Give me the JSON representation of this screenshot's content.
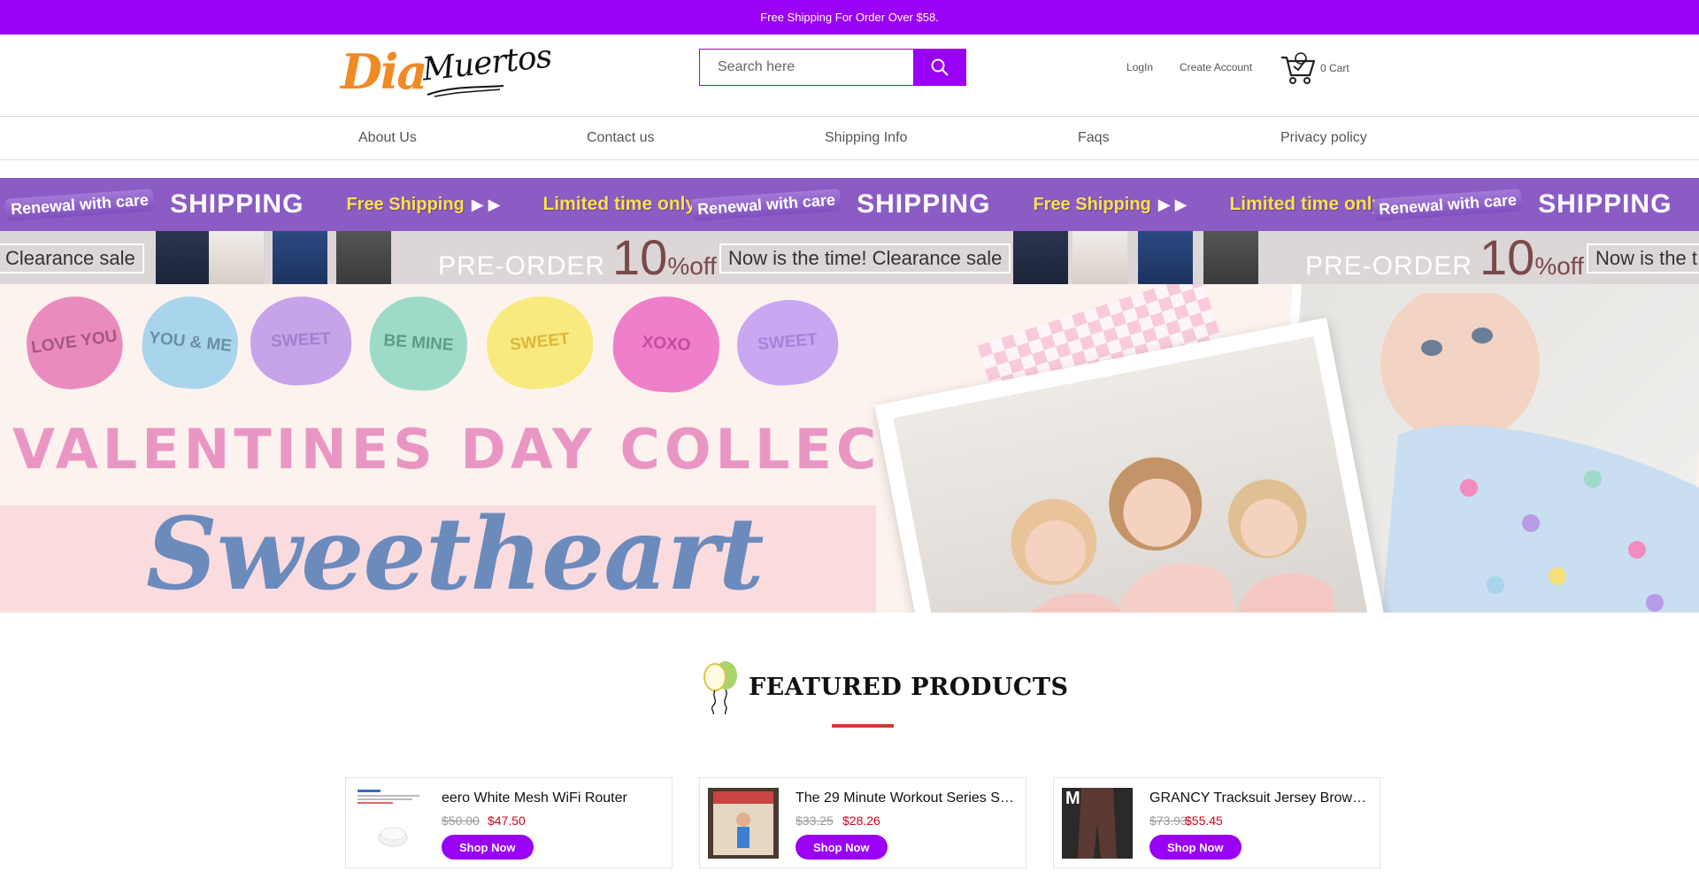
{
  "topbar": {
    "text": "Free Shipping For Order Over $58."
  },
  "header": {
    "logo": {
      "word1": "Dia",
      "word2": "Muertos"
    },
    "search": {
      "placeholder": "Search here"
    },
    "login": "LogIn",
    "create_account": "Create Account",
    "cart_label": "0 Cart"
  },
  "nav": {
    "items": [
      {
        "label": "About Us"
      },
      {
        "label": "Contact us"
      },
      {
        "label": "Shipping Info"
      },
      {
        "label": "Faqs"
      },
      {
        "label": "Privacy policy"
      }
    ]
  },
  "promo_strip1": {
    "renewal": "Renewal with care",
    "shipping": "SHIPPING",
    "free_shipping": "Free Shipping",
    "limited": "Limited time only"
  },
  "promo_strip2": {
    "clearance": "Clearance sale",
    "preorder": "PRE-ORDER",
    "discount_number": "10",
    "discount_suffix": "%off",
    "now_time": "Now is the time! Clearance sale",
    "now_time_cut": "Now is the t"
  },
  "hero": {
    "hearts": [
      "LOVE YOU",
      "YOU & ME",
      "SWEET",
      "BE MINE",
      "SWEET",
      "XOXO",
      "SWEET"
    ],
    "title": "VALENTINES DAY COLLECTION",
    "script": "Sweetheart"
  },
  "featured": {
    "title": "FEATURED PRODUCTS"
  },
  "products": [
    {
      "title": "eero White Mesh WiFi Router",
      "old_price": "$50.00",
      "new_price": "$47.50",
      "button": "Shop Now"
    },
    {
      "title": "The 29 Minute Workout Series S…",
      "old_price": "$33.25",
      "new_price": "$28.26",
      "button": "Shop Now"
    },
    {
      "title": "GRANCY Tracksuit Jersey Brown M",
      "old_price": "$73.93",
      "new_price": "$55.45",
      "button": "Shop Now"
    }
  ],
  "colors": {
    "brand": "#9a00f5",
    "price_red": "#d0021b",
    "divider_red": "#d13a3a"
  }
}
